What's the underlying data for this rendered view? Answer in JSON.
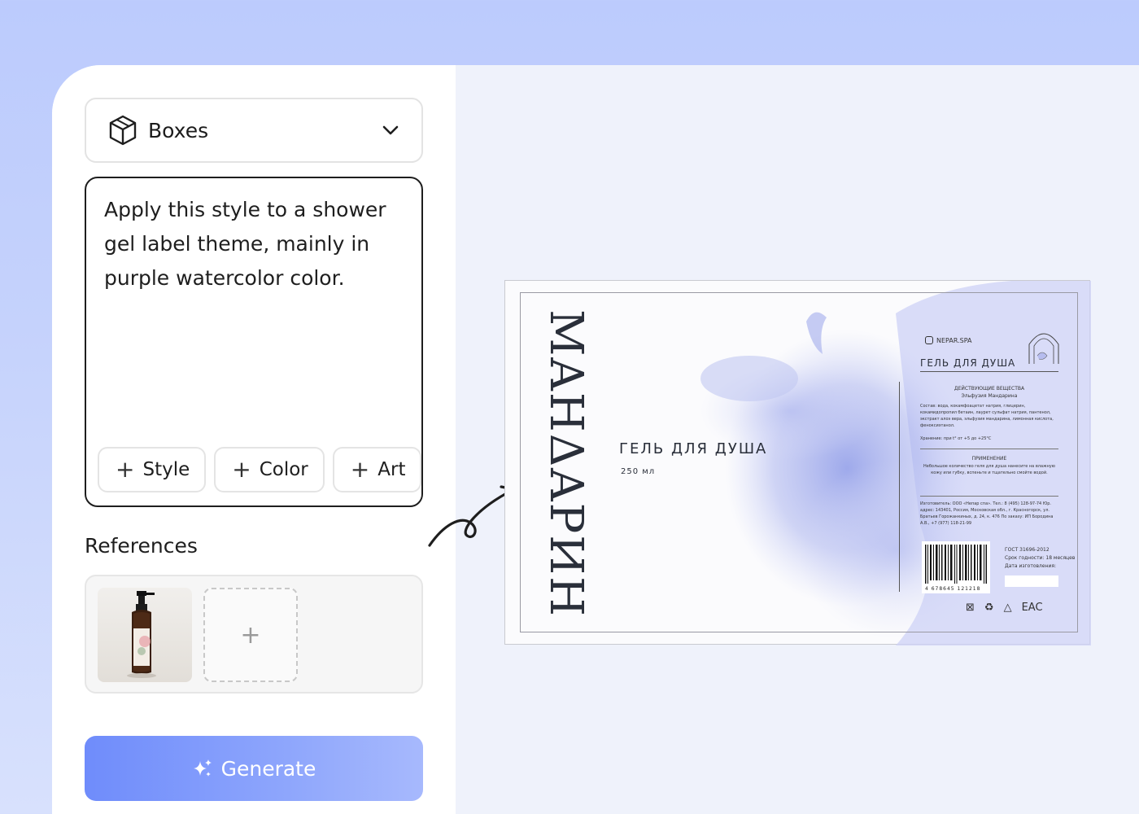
{
  "category_dropdown": {
    "icon": "box-icon",
    "value": "Boxes"
  },
  "prompt": {
    "text": "Apply this style to a shower gel label theme, mainly in purple watercolor color.",
    "chips": [
      "Style",
      "Color",
      "Art"
    ]
  },
  "references": {
    "title": "References",
    "add_symbol": "+"
  },
  "generate": {
    "label": "Generate",
    "icon": "sparkle-icon"
  },
  "preview": {
    "vertical_title": "ΜΑΗΔΑΡИΗ",
    "subtitle": "ГЕЛЬ ДЛЯ ДУША",
    "volume": "250 мл",
    "brand": "NEPAR.SPA",
    "right_title": "ГЕЛЬ ДЛЯ ДУША",
    "actives_title": "ДЕЙСТВУЮЩИЕ ВЕЩЕСТВА",
    "actives_sub": "Эльфузия Мандарина",
    "composition": "Состав: вода, кокамфоацетат натрия, глицерин, кокамидопропил бетаин, лаурет сульфат натрия, пантенол, экстракт алоэ вера, эльфузия мандарина, лимонная кислота, феноксиэтанол.",
    "storage": "Хранение: при t° от +5 до +25°С",
    "usage_title": "ПРИМЕНЕНИЕ",
    "usage": "Небольшое количество геля для душа нанесите на влажную кожу или губку, вспеньте и тщательно смойте водой.",
    "maker": "Изготовитель: ООО «Непар спа». Тел.: 8 (495) 128-97-74 Юр. адрес: 143401, Россия, Московская обл., г. Красногорск, ул. Братьев Горожанкиных, д. 24, к. 476 По заказу: ИП Бородина А.В., +7 (977) 118-21-99",
    "gost": "ГОСТ 31696-2012",
    "shelf": "Срок годности: 18 месяцев",
    "date_label": "Дата изготовления:",
    "barcode_digits": "4 678645 121218",
    "marks": [
      "⊠",
      "♻",
      "△",
      "EAC"
    ]
  },
  "colors": {
    "accent": "#7a91fb",
    "watercolor": "#9aa4ec",
    "ink": "#2a2f3a"
  }
}
